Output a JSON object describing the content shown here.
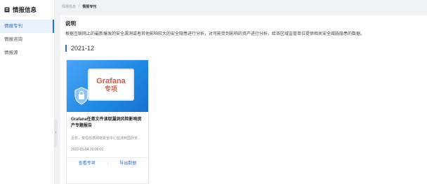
{
  "sidebar": {
    "title": "情报信息",
    "items": [
      {
        "label": "情报专刊",
        "active": true
      },
      {
        "label": "情报咨询",
        "active": false
      },
      {
        "label": "情报源",
        "active": false
      }
    ]
  },
  "breadcrumb": {
    "root": "情报信息",
    "separator": "/",
    "current": "情报专刊"
  },
  "main": {
    "desc_title": "说明",
    "desc_text": "根据互联网上的最新爆发的安全漏洞或者其他影响较大的安全隐患进行分析，对可能受到影响的资产进行分析，给各区域监管单位提供相关安全威胁隐患的数据。",
    "year": "2021-12",
    "card": {
      "cover_line1": "Grafana",
      "cover_line2": "专项",
      "title": "Grafana任意文件读取漏洞风险影响资产专题报告",
      "subtitle": "近日，安恒信息网络安全中心监测到国外安...",
      "date": "2022-01-04 20:00:01",
      "view_label": "查看专项",
      "export_label": "导出数据"
    }
  },
  "colors": {
    "accent": "#2a6fd9",
    "cover": "#1e88e5",
    "cover_text": "#e05a4a"
  }
}
